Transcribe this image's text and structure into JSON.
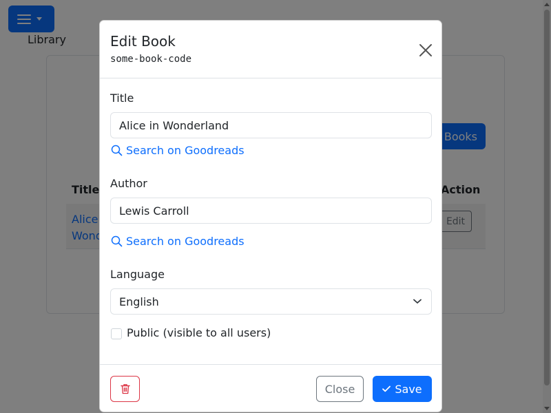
{
  "nav": {
    "title": "Library"
  },
  "background": {
    "books_button": "Books",
    "table": {
      "headers": [
        "Title",
        "Action"
      ],
      "rows": [
        {
          "title": "Alice in Wonderland",
          "action": "Edit"
        }
      ]
    }
  },
  "modal": {
    "title": "Edit Book",
    "subtitle": "some-book-code",
    "fields": {
      "title": {
        "label": "Title",
        "value": "Alice in Wonderland"
      },
      "author": {
        "label": "Author",
        "value": "Lewis Carroll"
      },
      "language": {
        "label": "Language",
        "value": "English"
      }
    },
    "goodreads_link": "Search on Goodreads",
    "public_checkbox": {
      "label": "Public (visible to all users)",
      "checked": false
    },
    "buttons": {
      "close": "Close",
      "save": "Save"
    }
  },
  "colors": {
    "primary": "#0d6efd",
    "danger": "#dc3545",
    "secondary": "#6c757d"
  }
}
